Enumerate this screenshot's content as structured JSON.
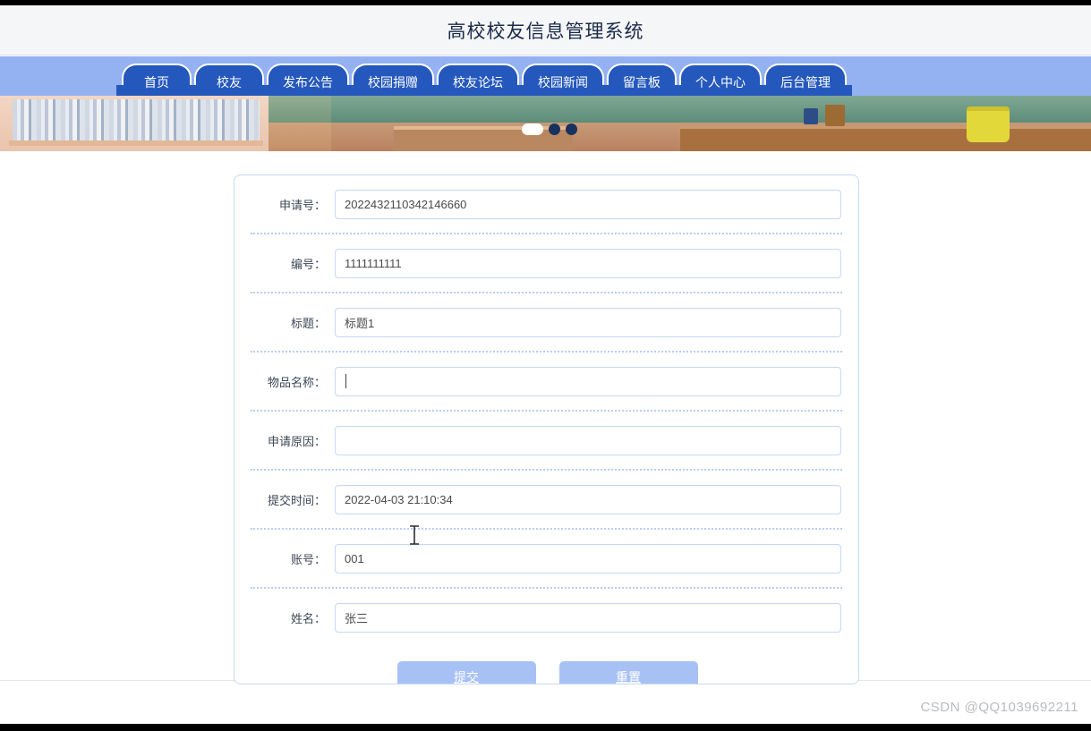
{
  "header": {
    "title": "高校校友信息管理系统"
  },
  "nav": {
    "items": [
      {
        "label": "首页",
        "name": "nav-item-home"
      },
      {
        "label": "校友",
        "name": "nav-item-alumni"
      },
      {
        "label": "发布公告",
        "name": "nav-item-announcements"
      },
      {
        "label": "校园捐赠",
        "name": "nav-item-donation"
      },
      {
        "label": "校友论坛",
        "name": "nav-item-forum"
      },
      {
        "label": "校园新闻",
        "name": "nav-item-news"
      },
      {
        "label": "留言板",
        "name": "nav-item-message-board"
      },
      {
        "label": "个人中心",
        "name": "nav-item-profile"
      },
      {
        "label": "后台管理",
        "name": "nav-item-admin"
      }
    ]
  },
  "banner": {
    "carousel": {
      "dots": 3,
      "active_index": 0
    }
  },
  "form": {
    "fields": [
      {
        "label": "申请号：",
        "value": "2022432110342146660",
        "name": "application-number",
        "empty": false
      },
      {
        "label": "编号：",
        "value": "1111111111",
        "name": "serial-number",
        "empty": false
      },
      {
        "label": "标题：",
        "value": "标题1",
        "name": "title",
        "empty": false
      },
      {
        "label": "物品名称：",
        "value": "",
        "name": "item-name",
        "empty": true,
        "focused": true
      },
      {
        "label": "申请原因：",
        "value": "",
        "name": "application-reason",
        "empty": true
      },
      {
        "label": "提交时间：",
        "value": "2022-04-03 21:10:34",
        "name": "submit-time",
        "empty": false
      },
      {
        "label": "账号：",
        "value": "001",
        "name": "account",
        "empty": false
      },
      {
        "label": "姓名：",
        "value": "张三",
        "name": "user-name",
        "empty": false
      }
    ],
    "buttons": {
      "submit": "提交",
      "reset": "重置"
    }
  },
  "watermark": "CSDN @QQ1039692211",
  "colors": {
    "nav_bar_bg": "#94b2f2",
    "nav_tab_bg": "#2558bd",
    "header_bg": "#f5f6f7",
    "title_text": "#1b2a4a",
    "field_border": "#c6d8f5",
    "divider": "#b9cdf0",
    "button_bg": "#a8c1f5",
    "watermark_text": "#b9bcc0"
  }
}
